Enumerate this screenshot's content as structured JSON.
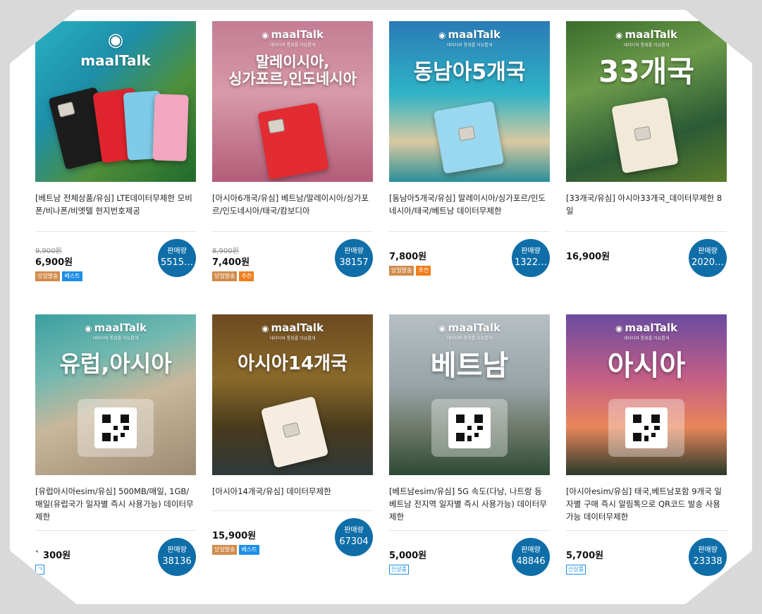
{
  "brand": {
    "name": "maalTalk",
    "tagline": "데이터와 통화를 자유롭게"
  },
  "sales_label": "판매량",
  "products": [
    {
      "headline": "",
      "title": "[베트남 전체상품/유심] LTE데이터무제한 모비폰/비나폰/비엣텔 현지번호제공",
      "old_price": "9,900원",
      "price": "6,900원",
      "sales": "5515…",
      "badges": [
        "당일발송",
        "베스트"
      ]
    },
    {
      "headline": "말레이시아,\n싱가포르,인도네시아",
      "title": "[아시아6개국/유심] 베트남/말레이시아/싱가포르/인도네시아/태국/캄보디아",
      "old_price": "8,900원",
      "price": "7,400원",
      "sales": "38157",
      "badges": [
        "당일발송",
        "추천"
      ]
    },
    {
      "headline": "동남아5개국",
      "title": "[동남아5개국/유심] 말레이시아/싱가포르/인도네시아/태국/베트남 데이터무제한",
      "old_price": "",
      "price": "7,800원",
      "sales": "1322…",
      "badges": [
        "당일발송",
        "추천"
      ]
    },
    {
      "headline": "33개국",
      "title": "[33개국/유심] 아시아33개국_데이터무제한 8일",
      "old_price": "",
      "price": "16,900원",
      "sales": "2020…",
      "badges": []
    },
    {
      "headline": "유럽,아시아",
      "title": "[유럽아시아esim/유심] 500MB/매일, 1GB/매일(유럽국가 일자별 즉시 사용가능) 데이터무제한",
      "old_price": "",
      "price": "` 300원",
      "sales": "38136",
      "badges": [
        "ㄱ"
      ]
    },
    {
      "headline": "아시아14개국",
      "title": "[아시아14개국/유심] 데이터무제한",
      "old_price": "",
      "price": "15,900원",
      "sales": "67304",
      "badges": [
        "당일발송",
        "베스트"
      ]
    },
    {
      "headline": "베트남",
      "title": "[베트남esim/유심] 5G 속도(다낭, 나트랑 등 베트남 전지역 일자별 즉시 사용가능) 데이터무제한",
      "old_price": "",
      "price": "5,000원",
      "sales": "48846",
      "badges": [
        "신상품"
      ]
    },
    {
      "headline": "아시아",
      "title": "[아시아esim/유심] 태국,베트남포함 9개국 일자별 구매 즉시 알림톡으로 QR코드 발송 사용 가능 데이터무제한",
      "old_price": "",
      "price": "5,700원",
      "sales": "23338",
      "badges": [
        "신상품"
      ]
    }
  ]
}
